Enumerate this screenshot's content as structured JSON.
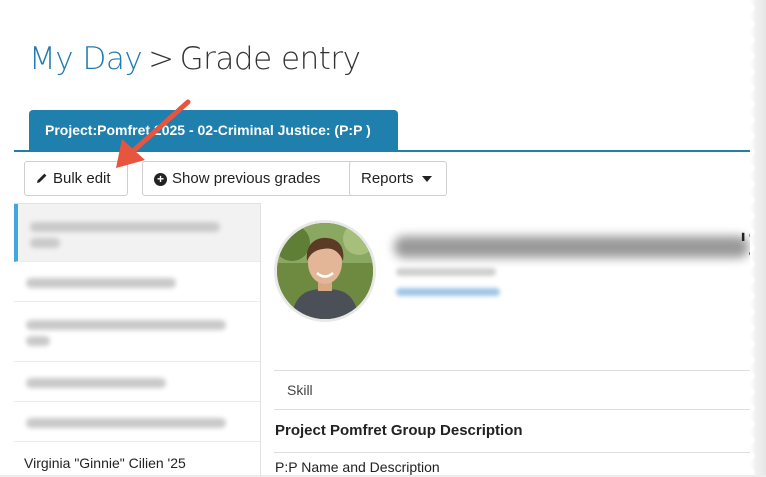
{
  "breadcrumb": {
    "link": "My Day",
    "separator": ">",
    "current": "Grade entry"
  },
  "tab": {
    "label": "Project:Pomfret 2025 - 02-Criminal Justice: (P:P )"
  },
  "toolbar": {
    "bulk_edit": "Bulk edit",
    "show_previous": "Show previous grades",
    "reports": "Reports"
  },
  "students": {
    "visible_name": "Virginia \"Ginnie\" Cilien '25"
  },
  "profile": {
    "name_fragment": "'2"
  },
  "skills": {
    "header": "Skill",
    "group": "Project Pomfret Group Description",
    "sub": "P:P Name and Description"
  },
  "colors": {
    "accent": "#1f7fad",
    "link": "#1f7bb0",
    "annotation_arrow": "#e8553f"
  }
}
